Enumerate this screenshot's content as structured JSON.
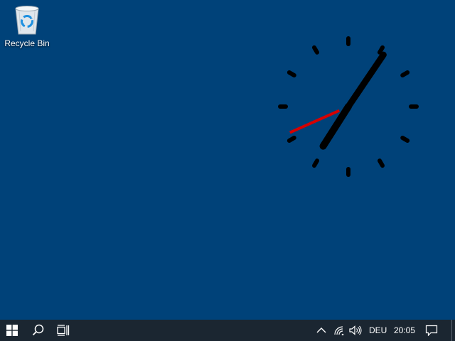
{
  "desktop": {
    "background_color": "#004279",
    "icons": [
      {
        "label": "Recycle Bin",
        "icon": "recycle-bin-icon"
      }
    ]
  },
  "clock": {
    "hour": 7,
    "minute": 5,
    "second": 41,
    "face_color": "#000000",
    "second_hand_color": "#d60000"
  },
  "taskbar": {
    "background_color": "#1b2631",
    "start_icon": "windows-logo-icon",
    "search_icon": "search-icon",
    "task_view_icon": "task-view-icon",
    "tray": {
      "show_hidden_icon": "chevron-up-icon",
      "network_icon": "wifi-icon",
      "volume_icon": "speaker-icon",
      "language": "DEU",
      "time": "20:05",
      "notifications_icon": "action-center-icon"
    }
  }
}
